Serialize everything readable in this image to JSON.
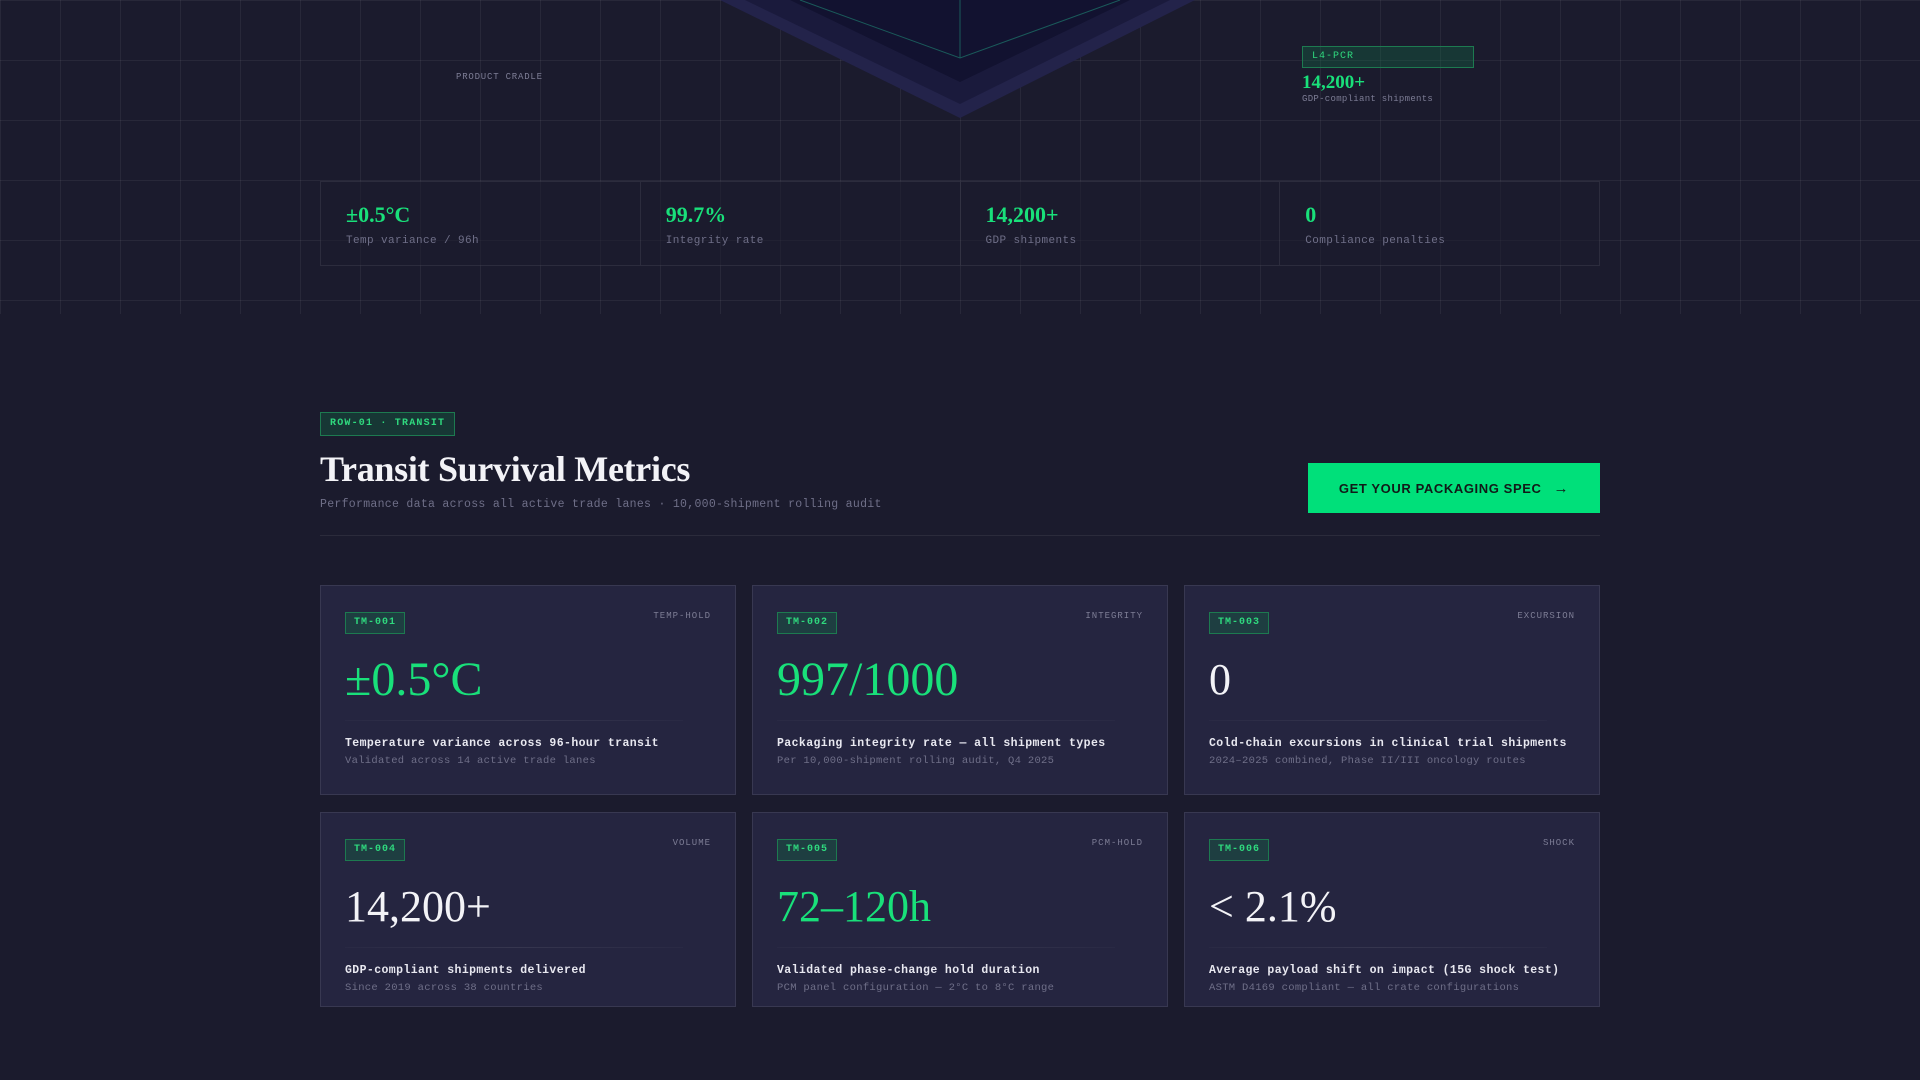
{
  "hero": {
    "cradle_label": "PRODUCT CRADLE",
    "l4": {
      "tag": "L4-PCR",
      "value": "14,200+",
      "sub": "GDP-compliant shipments"
    },
    "stats": [
      {
        "value": "±0.5°C",
        "label": "Temp variance / 96h"
      },
      {
        "value": "99.7%",
        "label": "Integrity rate"
      },
      {
        "value": "14,200+",
        "label": "GDP shipments"
      },
      {
        "value": "0",
        "label": "Compliance penalties"
      }
    ]
  },
  "section": {
    "tag": "ROW-01 · TRANSIT",
    "title": "Transit Survival Metrics",
    "subtitle": "Performance data across all active trade lanes · 10,000-shipment rolling audit",
    "cta_label": "GET YOUR PACKAGING SPEC",
    "cta_icon": "arrow-right-icon"
  },
  "cards": [
    {
      "id": "TM-001",
      "category": "TEMP-HOLD",
      "value": "±0.5°C",
      "title": "Temperature variance across 96-hour transit",
      "detail": "Validated across 14 active trade lanes"
    },
    {
      "id": "TM-002",
      "category": "INTEGRITY",
      "value": "997/1000",
      "title": "Packaging integrity rate — all shipment types",
      "detail": "Per 10,000-shipment rolling audit, Q4 2025"
    },
    {
      "id": "TM-003",
      "category": "EXCURSION",
      "value": "0",
      "title": "Cold-chain excursions in clinical trial shipments",
      "detail": "2024–2025 combined, Phase II/III oncology routes"
    },
    {
      "id": "TM-004",
      "category": "VOLUME",
      "value": "14,200+",
      "title": "GDP-compliant shipments delivered",
      "detail": "Since 2019 across 38 countries"
    },
    {
      "id": "TM-005",
      "category": "PCM-HOLD",
      "value": "72–120h",
      "title": "Validated phase-change hold duration",
      "detail": "PCM panel configuration — 2°C to 8°C range"
    },
    {
      "id": "TM-006",
      "category": "SHOCK",
      "value": "< 2.1%",
      "title": "Average payload shift on impact (15G shock test)",
      "detail": "ASTM D4169 compliant — all crate configurations"
    }
  ],
  "colors": {
    "accent": "#00e07a",
    "background": "#1b1b2d",
    "card": "#252540"
  }
}
